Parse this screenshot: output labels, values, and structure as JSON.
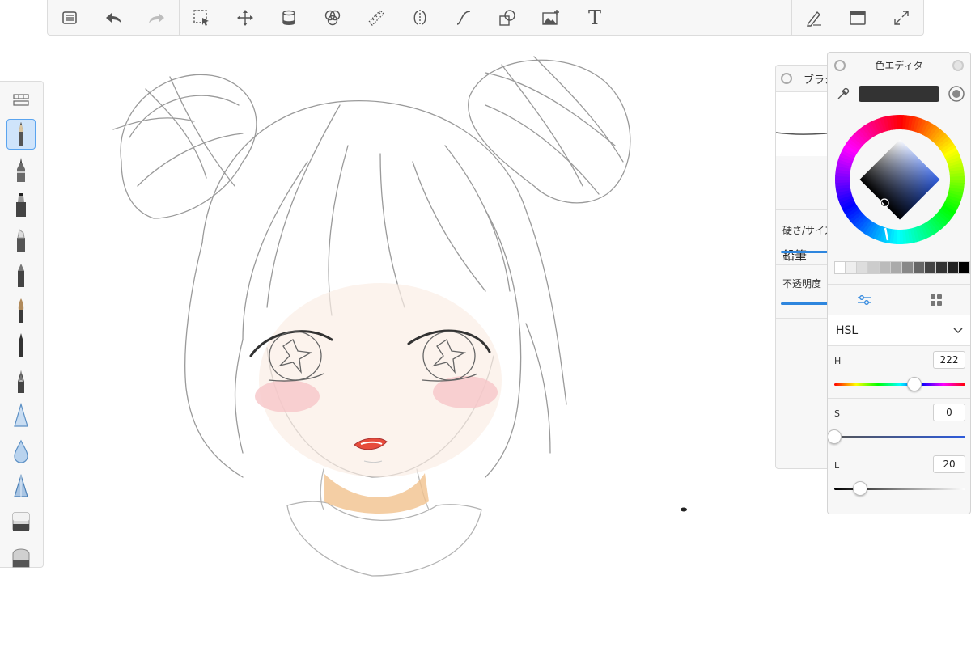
{
  "toolbar": {
    "left_tools": [
      {
        "name": "gallery-menu-icon"
      },
      {
        "name": "undo-icon"
      },
      {
        "name": "redo-icon",
        "disabled": true
      }
    ],
    "main_tools": [
      {
        "name": "selection-icon"
      },
      {
        "name": "transform-icon"
      },
      {
        "name": "paint-bucket-icon"
      },
      {
        "name": "color-blend-icon"
      },
      {
        "name": "ruler-icon"
      },
      {
        "name": "symmetry-icon"
      },
      {
        "name": "curve-icon"
      },
      {
        "name": "shape-icon"
      },
      {
        "name": "insert-image-icon"
      },
      {
        "name": "text-tool-icon",
        "glyph": "T"
      }
    ],
    "right_tools": [
      {
        "name": "pen-settings-icon"
      },
      {
        "name": "window-icon"
      },
      {
        "name": "fullscreen-icon"
      }
    ]
  },
  "brushes": [
    {
      "name": "brush-palette-toggle-icon"
    },
    {
      "name": "pencil-brush-icon",
      "active": true
    },
    {
      "name": "ink-pen-brush-icon"
    },
    {
      "name": "marker-brush-icon"
    },
    {
      "name": "chisel-marker-brush-icon"
    },
    {
      "name": "ballpoint-pen-brush-icon"
    },
    {
      "name": "paintbrush-brush-icon"
    },
    {
      "name": "fine-liner-brush-icon"
    },
    {
      "name": "fountain-pen-brush-icon"
    },
    {
      "name": "airbrush-brush-icon"
    },
    {
      "name": "watercolor-drop-brush-icon"
    },
    {
      "name": "smudge-brush-icon"
    },
    {
      "name": "soft-eraser-brush-icon"
    },
    {
      "name": "hard-eraser-brush-icon"
    }
  ],
  "brush_panel": {
    "title": "ブラシ",
    "brush_name": "鉛筆",
    "hardness_size_label": "硬さ/サイズ:",
    "opacity_label": "不透明度"
  },
  "color_editor": {
    "title": "色エディタ",
    "current_color": "#333333",
    "mode": "HSL",
    "channels": [
      {
        "label": "H",
        "value": "222",
        "fraction": 0.62
      },
      {
        "label": "S",
        "value": "0",
        "fraction": 0.0
      },
      {
        "label": "L",
        "value": "20",
        "fraction": 0.2
      }
    ],
    "grays": [
      "#ffffff",
      "#eeeeee",
      "#dddddd",
      "#cccccc",
      "#bbbbbb",
      "#aaaaaa",
      "#888888",
      "#666666",
      "#444444",
      "#333333",
      "#222222",
      "#000000"
    ]
  }
}
